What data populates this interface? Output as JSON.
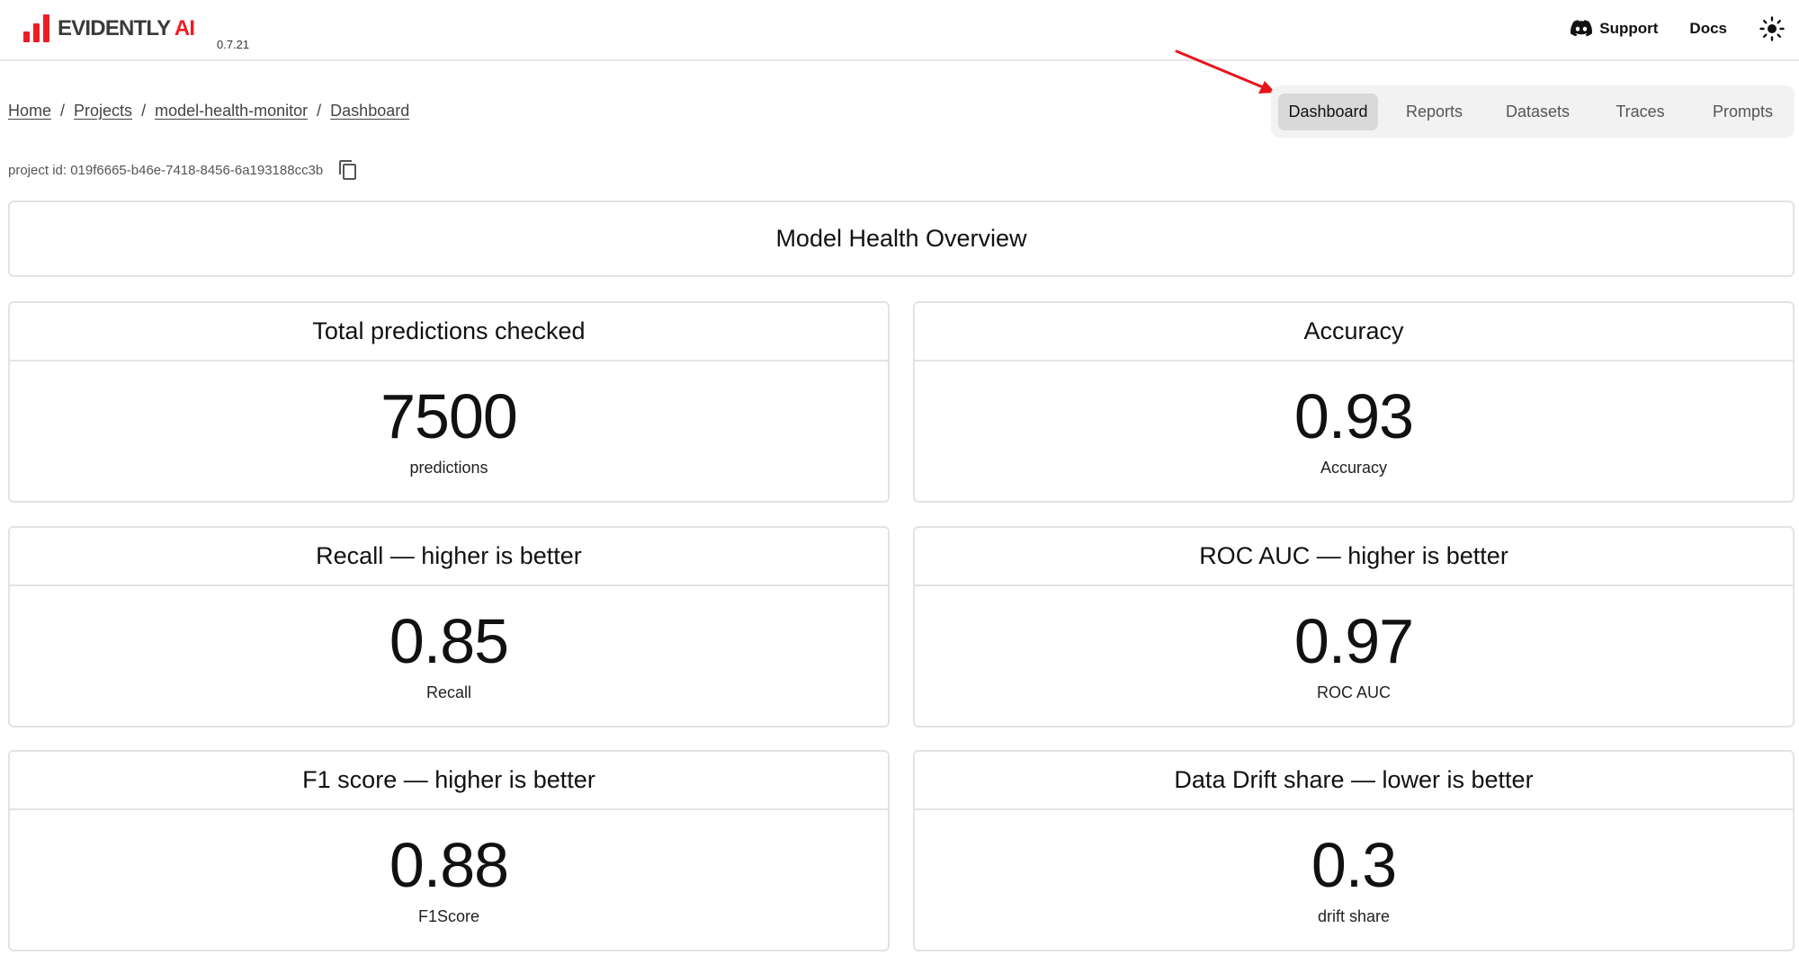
{
  "brand": {
    "name": "EVIDENTLY",
    "suffix": " AI",
    "version": "0.7.21",
    "accent": "#ed1c24"
  },
  "header": {
    "support_label": "Support",
    "docs_label": "Docs",
    "support_icon": "discord-icon",
    "theme_icon": "sun-icon"
  },
  "breadcrumb": [
    "Home",
    "Projects",
    "model-health-monitor",
    "Dashboard"
  ],
  "tabs": [
    {
      "label": "Dashboard",
      "active": true
    },
    {
      "label": "Reports",
      "active": false
    },
    {
      "label": "Datasets",
      "active": false
    },
    {
      "label": "Traces",
      "active": false
    },
    {
      "label": "Prompts",
      "active": false
    }
  ],
  "project": {
    "id_text": "project id: 019f6665-b46e-7418-8456-6a193188cc3b"
  },
  "dashboard": {
    "title": "Model Health Overview",
    "cards": [
      {
        "title": "Total predictions checked",
        "value": "7500",
        "unit": "predictions"
      },
      {
        "title": "Accuracy",
        "value": "0.93",
        "unit": "Accuracy"
      },
      {
        "title": "Recall — higher is better",
        "value": "0.85",
        "unit": "Recall"
      },
      {
        "title": "ROC AUC — higher is better",
        "value": "0.97",
        "unit": "ROC AUC"
      },
      {
        "title": "F1 score — higher is better",
        "value": "0.88",
        "unit": "F1Score"
      },
      {
        "title": "Data Drift share — lower is better",
        "value": "0.3",
        "unit": "drift share"
      }
    ]
  },
  "annotation": {
    "arrow_color": "#e8141c"
  }
}
